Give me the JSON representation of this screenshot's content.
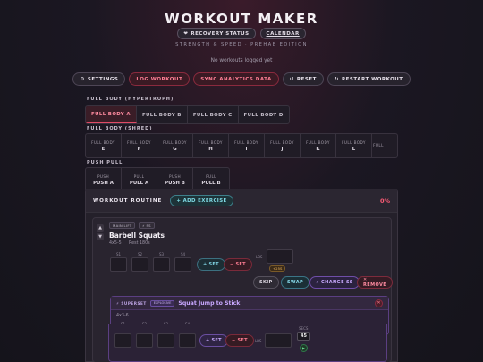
{
  "header": {
    "title": "WORKOUT MAKER",
    "recovery_icon": "heart-icon",
    "recovery_label": "RECOVERY STATUS",
    "calendar_label": "CALENDAR",
    "subtitle": "STRENGTH & SPEED · PREHAB EDITION",
    "no_logs": "No workouts logged yet"
  },
  "toolbar": {
    "settings": "SETTINGS",
    "log_workout": "LOG WORKOUT",
    "sync": "SYNC ANALYTICS DATA",
    "reset": "RESET",
    "restart": "RESTART WORKOUT"
  },
  "sections": {
    "hypertrophy": {
      "label": "FULL BODY (HYPERTROPH)",
      "tabs": [
        "FULL BODY A",
        "FULL BODY B",
        "FULL BODY C",
        "FULL BODY D"
      ],
      "active_index": 0
    },
    "shred": {
      "label": "FULL BODY (SHRED)",
      "tabs": [
        {
          "top": "FULL BODY",
          "bottom": "E"
        },
        {
          "top": "FULL BODY",
          "bottom": "F"
        },
        {
          "top": "FULL BODY",
          "bottom": "G"
        },
        {
          "top": "FULL BODY",
          "bottom": "H"
        },
        {
          "top": "FULL BODY",
          "bottom": "I"
        },
        {
          "top": "FULL BODY",
          "bottom": "J"
        },
        {
          "top": "FULL BODY",
          "bottom": "K"
        },
        {
          "top": "FULL BODY",
          "bottom": "L"
        },
        {
          "top": "FULL",
          "bottom": ""
        }
      ]
    },
    "push_pull": {
      "label": "PUSH PULL",
      "tabs": [
        {
          "top": "PUSH",
          "bottom": "PUSH A"
        },
        {
          "top": "PULL",
          "bottom": "PULL A"
        },
        {
          "top": "PUSH",
          "bottom": "PUSH B"
        },
        {
          "top": "PULL",
          "bottom": "PULL B"
        }
      ]
    }
  },
  "routine": {
    "title": "WORKOUT ROUTINE",
    "add_exercise": "+ ADD EXERCISE",
    "progress": "0%",
    "exercise": {
      "tag1": "MAIN LIFT",
      "tag2": "⚡ SS",
      "name": "Barbell Squats",
      "sets": "4x5-5",
      "rest": "Rest 180s",
      "slots": [
        "S1",
        "S2",
        "S3",
        "S4"
      ],
      "add_set": "+ SET",
      "remove_set": "− SET",
      "lbs": "LBS",
      "badge": "+25S",
      "skip": "SKIP",
      "swap": "SWAP",
      "change_ss": "⚡ CHANGE SS",
      "remove": "✕ REMOVE"
    },
    "superset": {
      "label": "⚡ SUPERSET",
      "tag": "EXPLOSIVE",
      "name": "Squat Jump to Stick",
      "sets": "4x3-6",
      "slots": [
        "S1",
        "S2",
        "S3",
        "S4"
      ],
      "add_set": "+ SET",
      "remove_set": "− SET",
      "lbs": "LBS",
      "secs_label": "SECS",
      "secs_value": "45",
      "close": "✕"
    }
  }
}
